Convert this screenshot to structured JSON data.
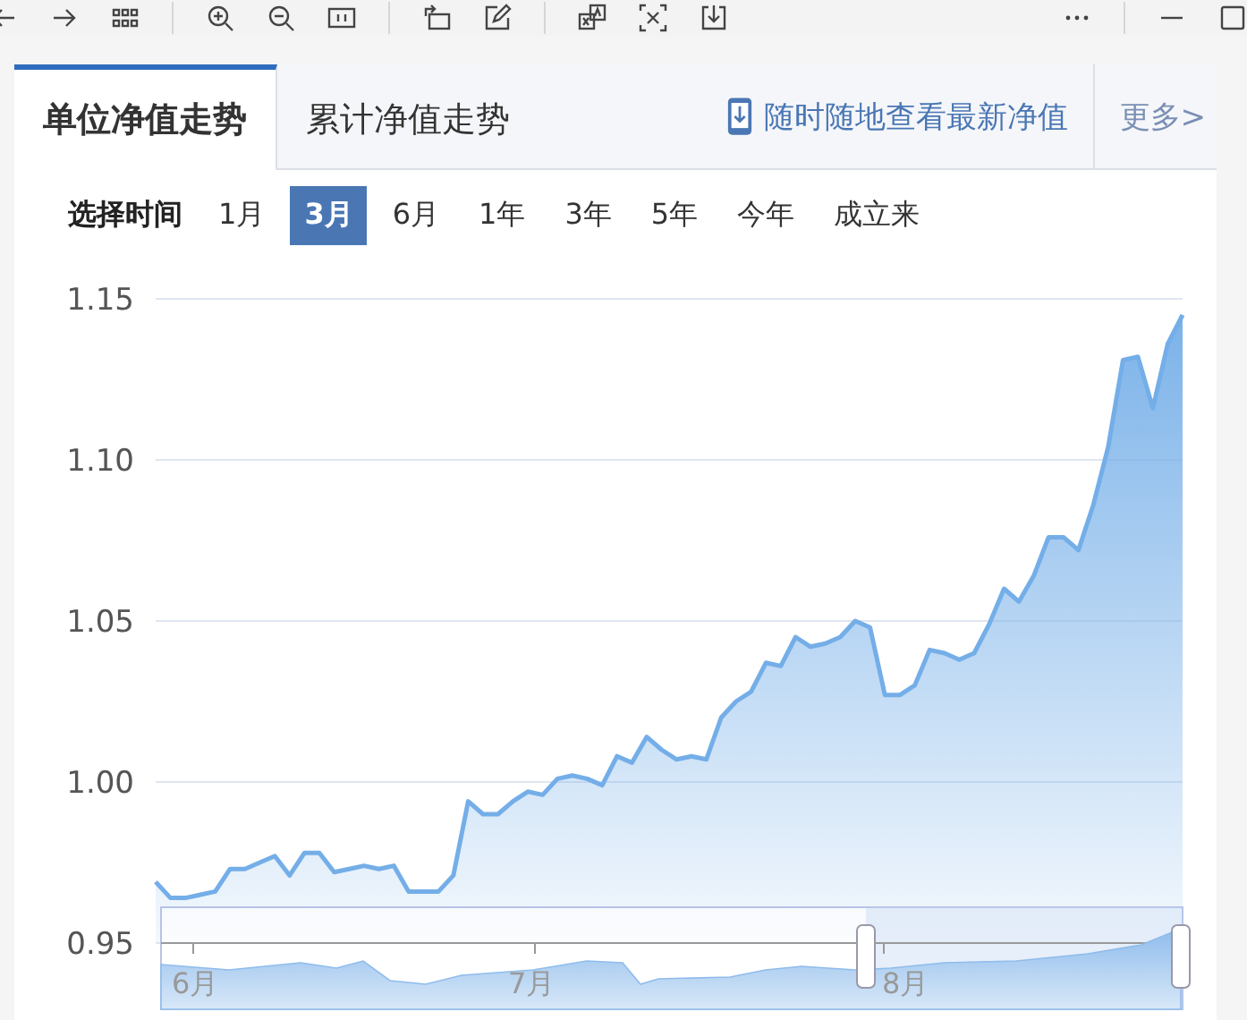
{
  "tabs": [
    {
      "label": "单位净值走势",
      "selected": true
    },
    {
      "label": "累计净值走势",
      "selected": false
    }
  ],
  "promo": {
    "text": "随时随地查看最新净值"
  },
  "more": {
    "text": "更多>"
  },
  "period": {
    "label": "选择时间",
    "options": [
      {
        "label": "1月",
        "selected": false
      },
      {
        "label": "3月",
        "selected": true
      },
      {
        "label": "6月",
        "selected": false
      },
      {
        "label": "1年",
        "selected": false
      },
      {
        "label": "3年",
        "selected": false
      },
      {
        "label": "5年",
        "selected": false
      },
      {
        "label": "今年",
        "selected": false
      },
      {
        "label": "成立来",
        "selected": false
      }
    ]
  },
  "chart": {
    "chart_data": {
      "type": "area",
      "grid": true,
      "ylim": [
        0.95,
        1.15
      ],
      "yticks": [
        {
          "value": 0.95,
          "label": "0.95"
        },
        {
          "value": 1.0,
          "label": "1.00"
        },
        {
          "value": 1.05,
          "label": "1.05"
        },
        {
          "value": 1.1,
          "label": "1.10"
        },
        {
          "value": 1.15,
          "label": "1.15"
        }
      ],
      "values": [
        0.969,
        0.964,
        0.964,
        0.965,
        0.966,
        0.973,
        0.973,
        0.975,
        0.977,
        0.971,
        0.978,
        0.978,
        0.972,
        0.973,
        0.974,
        0.973,
        0.974,
        0.966,
        0.966,
        0.966,
        0.971,
        0.994,
        0.99,
        0.99,
        0.994,
        0.997,
        0.996,
        1.001,
        1.002,
        1.001,
        0.999,
        1.008,
        1.006,
        1.014,
        1.01,
        1.007,
        1.008,
        1.007,
        1.02,
        1.025,
        1.028,
        1.037,
        1.036,
        1.045,
        1.042,
        1.043,
        1.045,
        1.05,
        1.048,
        1.027,
        1.027,
        1.03,
        1.041,
        1.04,
        1.038,
        1.04,
        1.049,
        1.06,
        1.056,
        1.064,
        1.076,
        1.076,
        1.072,
        1.086,
        1.104,
        1.131,
        1.132,
        1.116,
        1.136,
        1.145
      ]
    }
  },
  "overview": {
    "axis_labels": [
      "6月",
      "7月",
      "8月"
    ]
  }
}
